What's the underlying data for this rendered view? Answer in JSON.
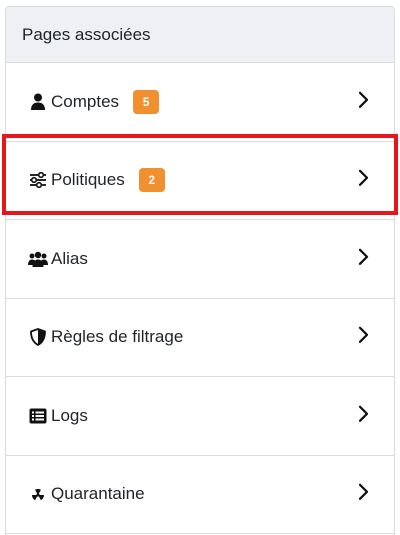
{
  "panel": {
    "title": "Pages associées"
  },
  "items": [
    {
      "label": "Comptes",
      "icon": "user-icon",
      "badge": "5"
    },
    {
      "label": "Politiques",
      "icon": "sliders-icon",
      "badge": "2"
    },
    {
      "label": "Alias",
      "icon": "users-icon"
    },
    {
      "label": "Règles de filtrage",
      "icon": "shield-icon"
    },
    {
      "label": "Logs",
      "icon": "list-icon"
    },
    {
      "label": "Quarantaine",
      "icon": "radiation-icon"
    }
  ],
  "colors": {
    "badge": "#f0902e",
    "highlight": "#e5161c",
    "header_bg": "#eef0f3",
    "border": "#d9dde1"
  }
}
